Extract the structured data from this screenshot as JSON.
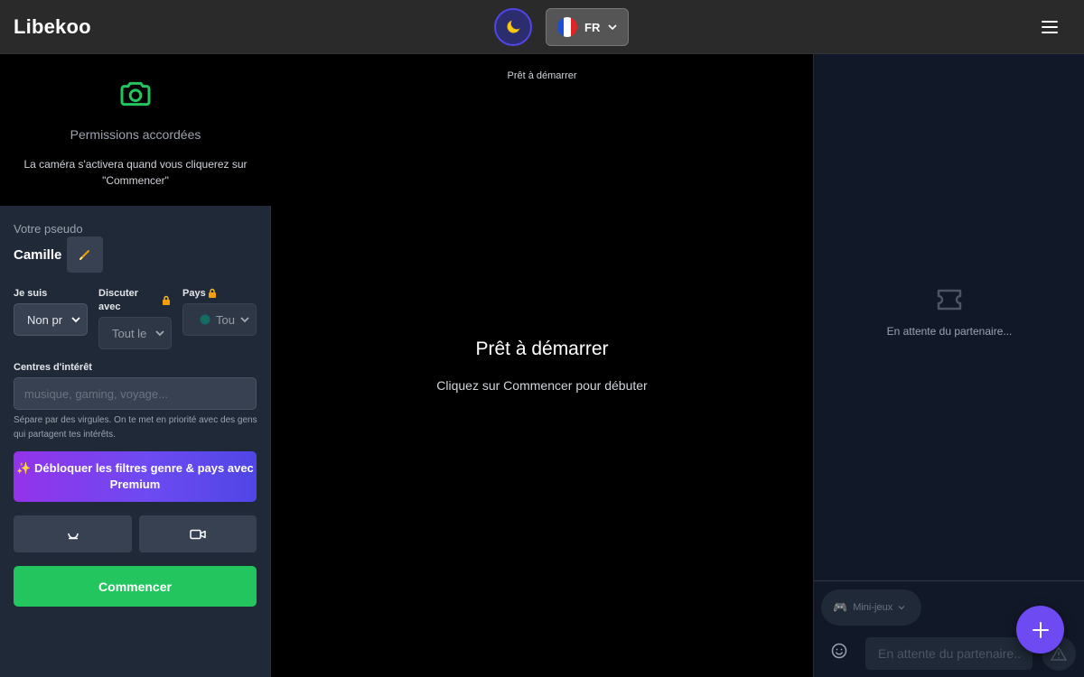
{
  "app": {
    "name": "Libekoo"
  },
  "header": {
    "theme_icon": "moon-icon",
    "language": {
      "code": "FR",
      "flag": "flag-fr-icon"
    },
    "menu_icon": "hamburger-menu-icon"
  },
  "camera": {
    "icon": "camera-icon",
    "title": "Permissions accordées",
    "description": "La caméra s'activera quand vous cliquerez sur \"Commencer\""
  },
  "profile": {
    "pseudo_label": "Votre pseudo",
    "pseudo_value": "Camille",
    "edit_icon": "pencil-icon"
  },
  "filters": {
    "gender": {
      "label": "Je suis",
      "value": "Non pr"
    },
    "chat_with": {
      "label": "Discuter avec",
      "value": "Tout le",
      "locked": true
    },
    "country": {
      "label": "Pays",
      "value": "Tou",
      "locked": true
    }
  },
  "interests": {
    "label": "Centres d'intérêt",
    "placeholder": "musique, gaming, voyage...",
    "value": "",
    "hint": "Sépare par des virgules. On te met en priorité avec des gens qui partagent tes intérêts."
  },
  "premium": {
    "icon": "sparkles-icon",
    "label": "Débloquer les filtres genre & pays avec Premium"
  },
  "controls": {
    "mic_icon": "microphone-icon",
    "video_icon": "video-camera-icon"
  },
  "start_button": {
    "label": "Commencer"
  },
  "video": {
    "status": "Prêt à démarrer",
    "title": "Prêt à démarrer",
    "subtitle": "Cliquez sur Commencer pour débuter"
  },
  "chat": {
    "waiting_icon": "ticket-icon",
    "waiting_text": "En attente du partenaire...",
    "games_label": "Mini-jeux",
    "input_placeholder": "En attente du partenaire...",
    "emoji_icon": "smiley-icon",
    "report_icon": "warning-icon"
  },
  "fab": {
    "icon": "plus-icon"
  },
  "colors": {
    "accent": "#22c55e",
    "premium_start": "#9333ea",
    "premium_end": "#4f46e5",
    "fab": "#6d4af2"
  }
}
